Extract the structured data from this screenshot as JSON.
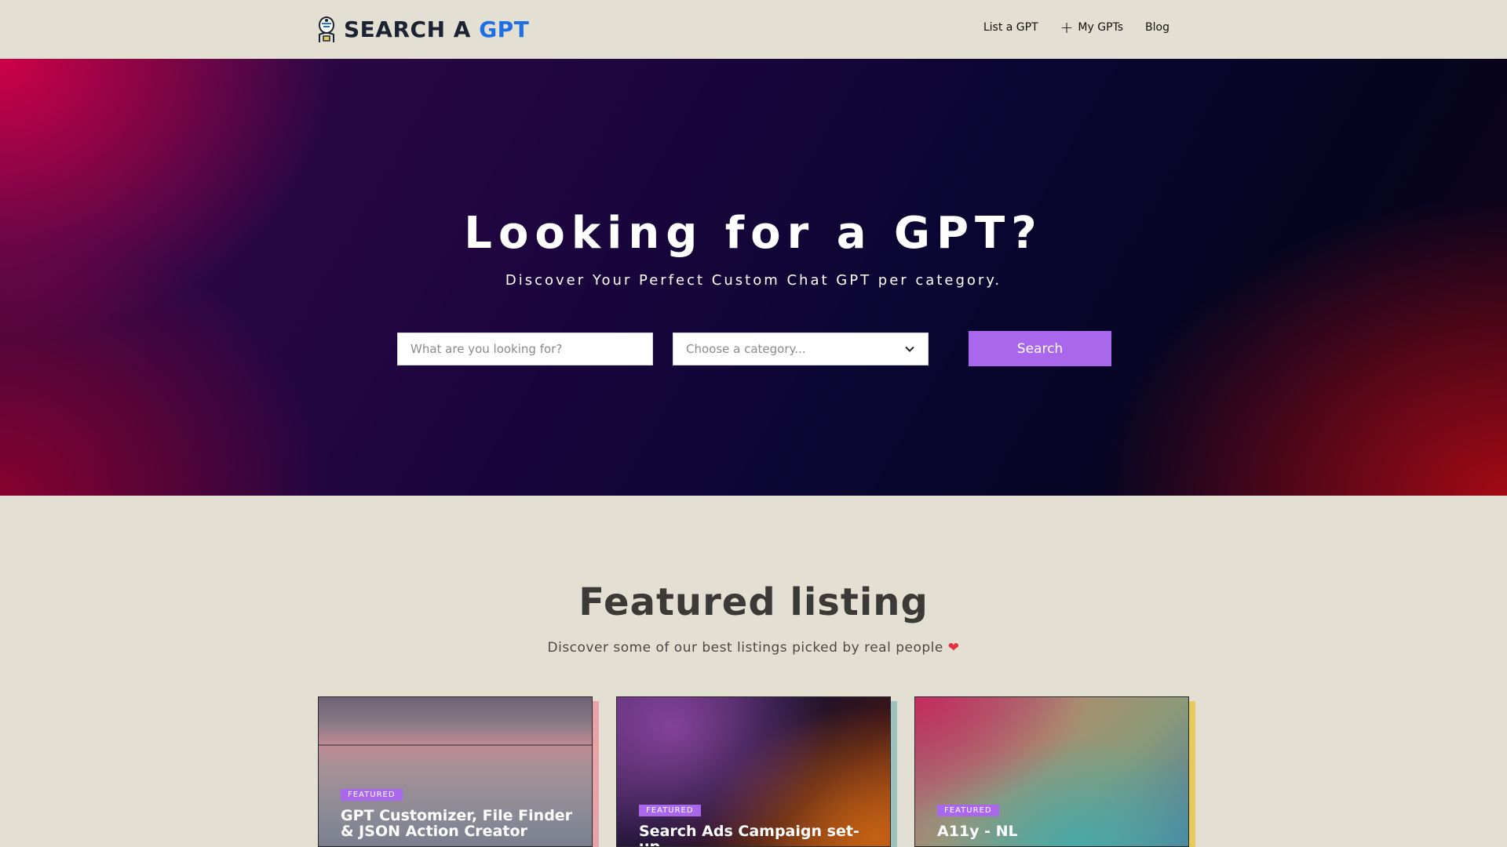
{
  "header": {
    "brand_main": "SEARCH A",
    "brand_accent": "GPT",
    "logo_icon": "robot-head-icon",
    "nav": [
      {
        "label": "List a GPT"
      },
      {
        "label": "My GPTs",
        "icon": "plus-icon"
      },
      {
        "label": "Blog"
      }
    ]
  },
  "hero": {
    "title": "Looking for a GPT?",
    "subtitle": "Discover Your Perfect Custom Chat GPT per category.",
    "search_placeholder": "What are you looking for?",
    "category_placeholder": "Choose a category...",
    "search_button": "Search"
  },
  "featured": {
    "title": "Featured listing",
    "subtitle": "Discover some of our best listings picked by real people",
    "subtitle_icon": "heart-icon",
    "cards": [
      {
        "badge": "FEATURED",
        "title": "GPT Customizer, File Finder & JSON Action Creator"
      },
      {
        "badge": "FEATURED",
        "title": "Search Ads Campaign set-up"
      },
      {
        "badge": "FEATURED",
        "title": "A11y - NL"
      }
    ]
  },
  "colors": {
    "accent": "#a967ec",
    "brand_blue": "#1e6fe6",
    "page_bg": "#e3dfd2"
  }
}
